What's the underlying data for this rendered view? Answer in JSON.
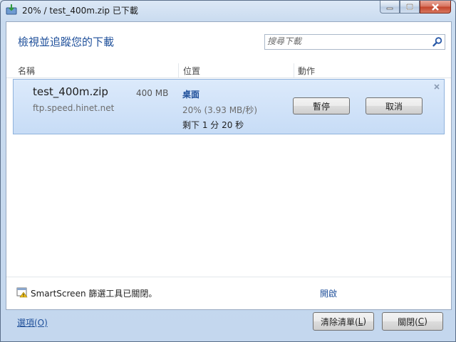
{
  "window": {
    "title": "20% / test_400m.zip 已下載"
  },
  "header": {
    "heading": "檢視並追蹤您的下載",
    "search_placeholder": "搜尋下載"
  },
  "columns": {
    "name": "名稱",
    "location": "位置",
    "action": "動作"
  },
  "download": {
    "filename": "test_400m.zip",
    "size": "400 MB",
    "host": "ftp.speed.hinet.net",
    "location": "桌面",
    "progress_text": "20% (3.93 MB/秒)",
    "progress_percent": 20,
    "remaining": "剩下 1 分 20 秒",
    "pause_label": "暫停",
    "cancel_label": "取消"
  },
  "smartscreen": {
    "text": "SmartScreen 篩選工具已關閉。",
    "action_label": "開啟"
  },
  "footer": {
    "options_label": "選項(O)",
    "clear_label": "清除清單(",
    "clear_accel": "L",
    "close_label": "關閉(",
    "close_accel": "C"
  },
  "colors": {
    "accent_blue": "#1e4f9a",
    "item_bg": "#c7dcf6",
    "close_red": "#c2432a"
  }
}
